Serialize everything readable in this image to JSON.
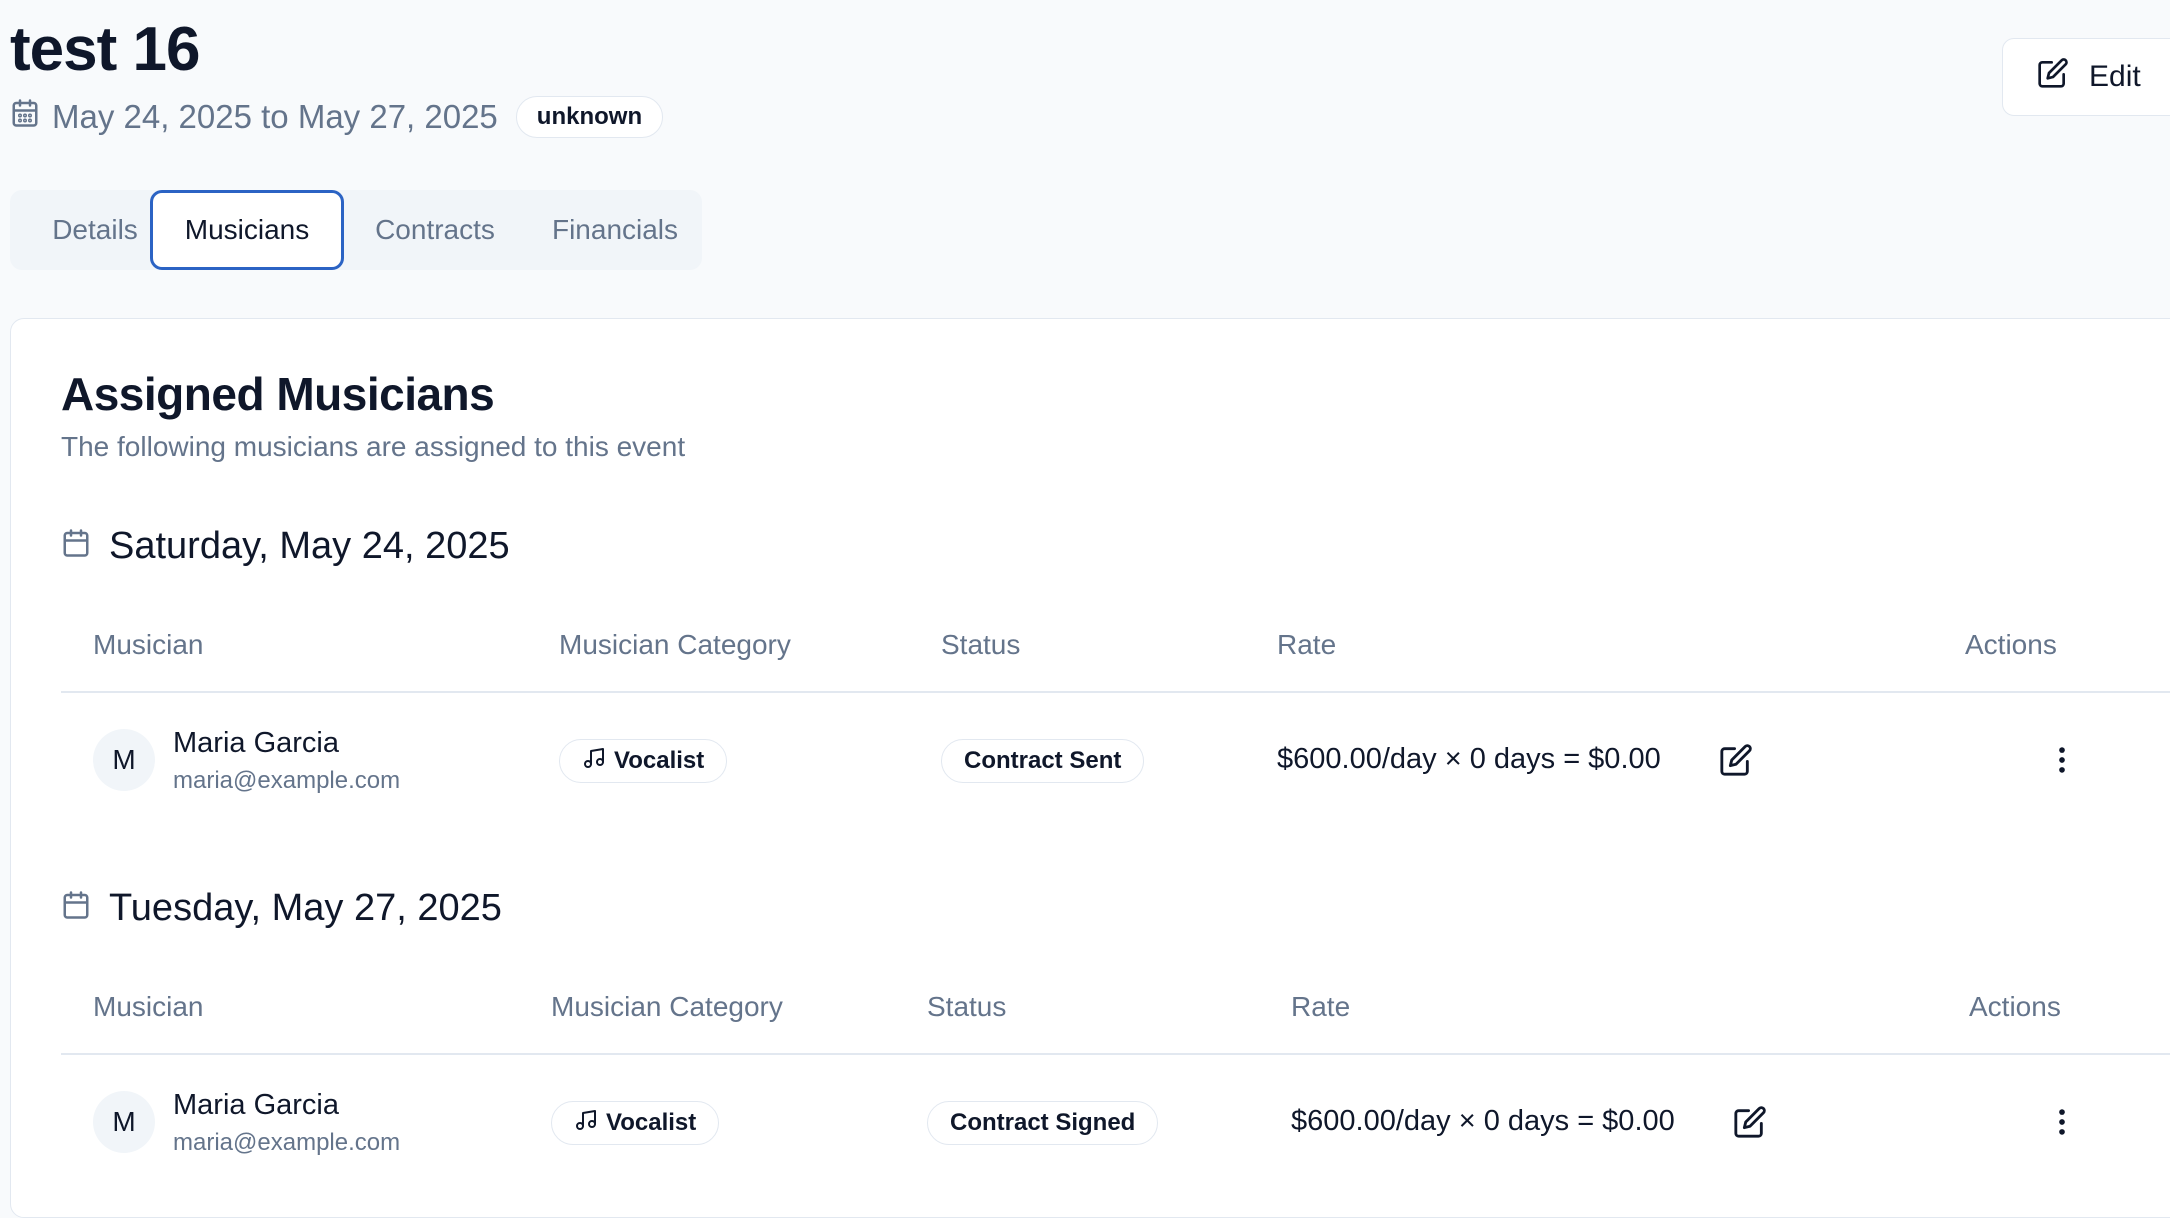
{
  "event": {
    "title": "test 16",
    "date_range": "May 24, 2025 to May 27, 2025",
    "status_badge": "unknown",
    "edit_label": "Edit"
  },
  "tabs": [
    {
      "label": "Details",
      "active": false
    },
    {
      "label": "Musicians",
      "active": true
    },
    {
      "label": "Contracts",
      "active": false
    },
    {
      "label": "Financials",
      "active": false
    }
  ],
  "card": {
    "title": "Assigned Musicians",
    "description": "The following musicians are assigned to this event"
  },
  "columns": [
    "Musician",
    "Musician Category",
    "Status",
    "Rate",
    "Actions"
  ],
  "days": [
    {
      "date": "Saturday, May 24, 2025",
      "rows": [
        {
          "avatar_initial": "M",
          "name": "Maria Garcia",
          "email": "maria@example.com",
          "category": "Vocalist",
          "status": "Contract Sent",
          "rate": "$600.00/day × 0 days = $0.00"
        }
      ]
    },
    {
      "date": "Tuesday, May 27, 2025",
      "rows": [
        {
          "avatar_initial": "M",
          "name": "Maria Garcia",
          "email": "maria@example.com",
          "category": "Vocalist",
          "status": "Contract Signed",
          "rate": "$600.00/day × 0 days = $0.00"
        }
      ]
    }
  ],
  "icons": {
    "calendar": "calendar-icon",
    "edit": "pencil-square-icon",
    "music": "music-note-icon",
    "more": "more-vertical-icon"
  },
  "colors": {
    "active_tab_border": "#2b63c4",
    "muted_text": "#64748b",
    "page_background": "#f8fafc"
  }
}
